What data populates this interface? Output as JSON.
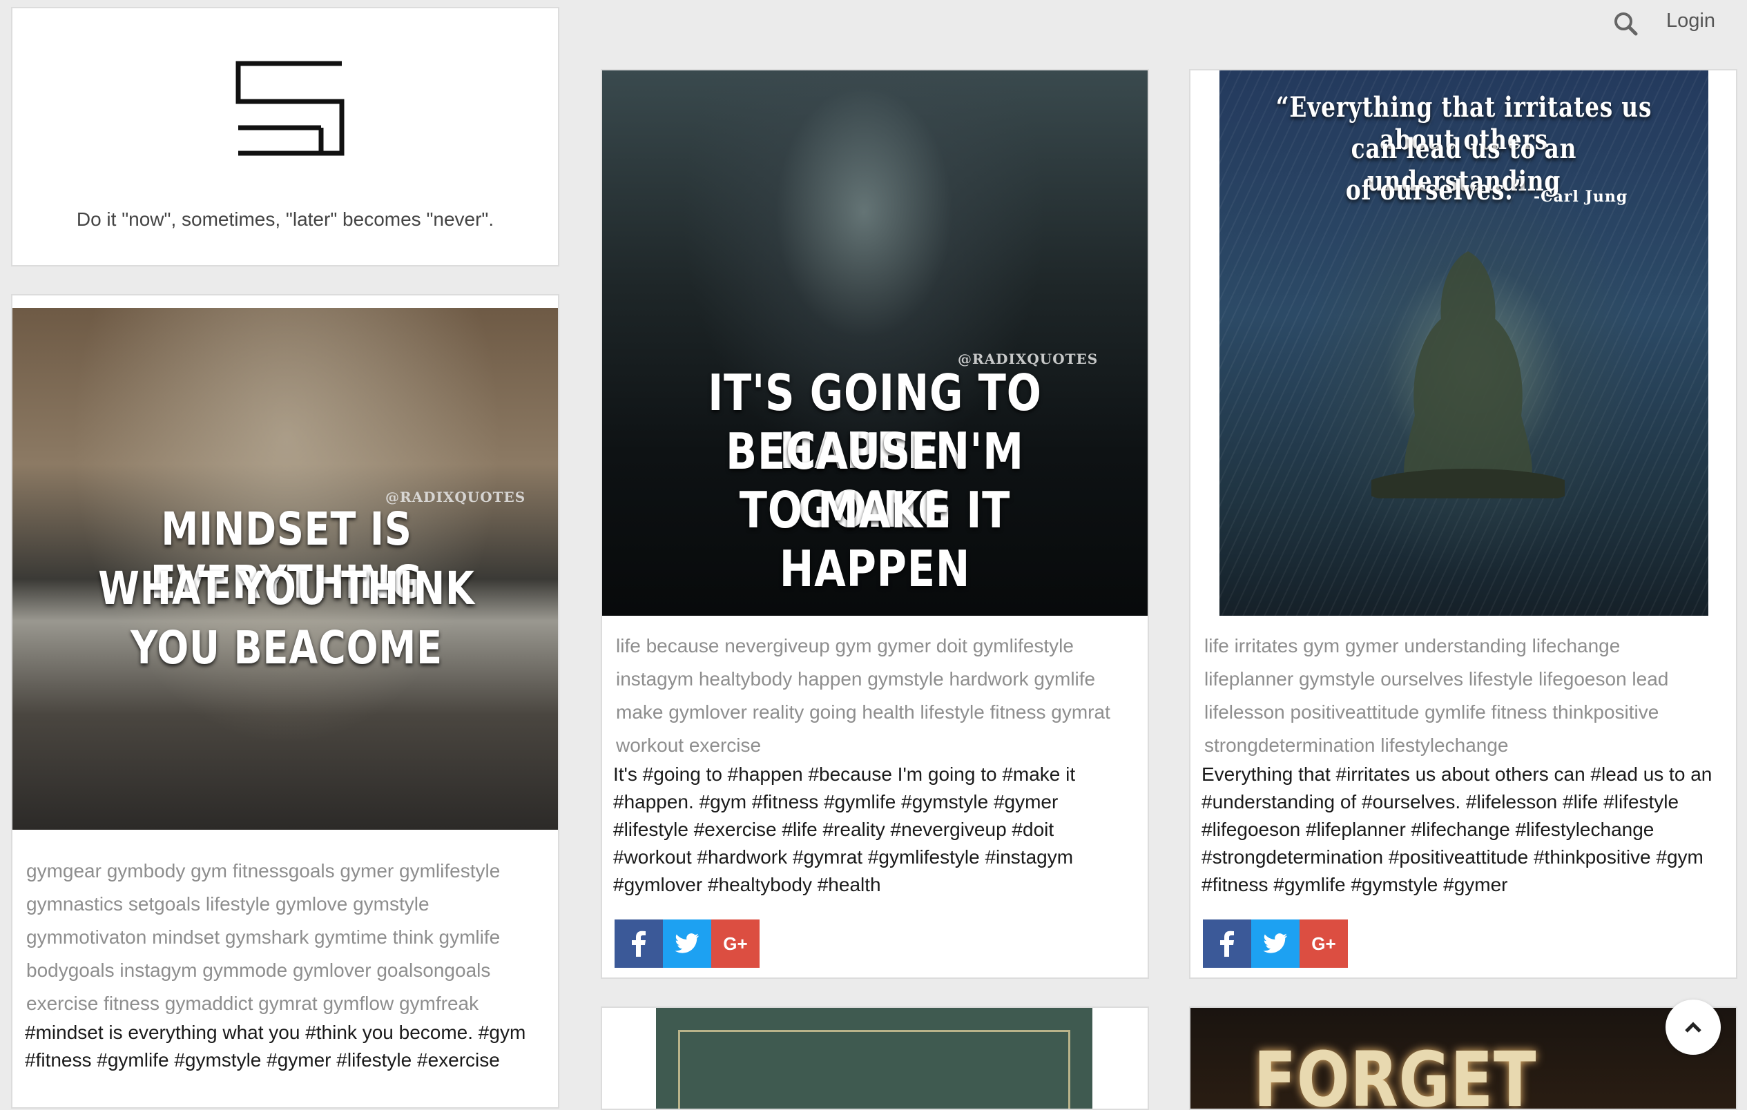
{
  "header": {
    "search_icon": "search-icon",
    "login_label": "Login"
  },
  "logo_card": {
    "logo_icon": "stacked-lines-logo-icon",
    "motto": "Do it \"now\", sometimes, \"later\" becomes \"never\"."
  },
  "posts": [
    {
      "image_text_lines": [
        "MINDSET IS EVERYTHING",
        "WHAT YOU THINK",
        "YOU BEACOME"
      ],
      "image_credit": "@RADIXQUOTES",
      "tags_lines": [
        "gymgear gymbody gym fitnessgoals gymer gymlifestyle",
        "gymnastics setgoals lifestyle gymlove gymstyle",
        "gymmotivaton mindset gymshark gymtime think gymlife",
        "bodygoals instagym gymmode gymlover goalsongoals",
        "exercise fitness gymaddict gymrat gymflow gymfreak"
      ],
      "caption_lines": [
        "#mindset is everything what you #think you become. #gym",
        "#fitness #gymlife #gymstyle #gymer #lifestyle #exercise"
      ]
    },
    {
      "image_text_lines": [
        "IT'S GOING TO HAPPEN",
        "BECAUSE I'M GOING",
        "TO MAKE IT",
        "HAPPEN"
      ],
      "image_credit": "@RADIXQUOTES",
      "tags_lines": [
        "life because nevergiveup gym gymer doit gymlifestyle",
        "instagym healtybody happen gymstyle hardwork gymlife",
        "make gymlover reality going health lifestyle fitness gymrat",
        "workout exercise"
      ],
      "caption_lines": [
        "It's #going to #happen #because I'm going to #make it",
        "#happen. #gym #fitness #gymlife #gymstyle #gymer",
        "#lifestyle #exercise #life #reality #nevergiveup #doit",
        "#workout #hardwork #gymrat #gymlifestyle #instagym",
        "#gymlover #healtybody #health"
      ]
    },
    {
      "image_text_lines": [
        "“Everything that irritates us about others",
        "can lead us to an understanding",
        "of ourselves.”"
      ],
      "image_credit": "-Carl Jung",
      "tags_lines": [
        "life irritates gym gymer understanding lifechange",
        "lifeplanner gymstyle ourselves lifestyle lifegoeson lead",
        "lifelesson positiveattitude gymlife fitness thinkpositive",
        "strongdetermination lifestylechange"
      ],
      "caption_lines": [
        "Everything that #irritates us about others can #lead us to an",
        "#understanding of #ourselves. #lifelesson #life #lifestyle",
        "#lifegoeson #lifeplanner #lifechange #lifestylechange",
        "#strongdetermination #positiveattitude #thinkpositive #gym",
        "#fitness #gymlife #gymstyle #gymer"
      ]
    },
    {
      "image_text_lines": [
        "FORGET"
      ]
    }
  ],
  "share": {
    "facebook_icon": "facebook-icon",
    "twitter_icon": "twitter-icon",
    "googleplus_label": "G+"
  },
  "scroll_top_icon": "chevron-up-icon"
}
